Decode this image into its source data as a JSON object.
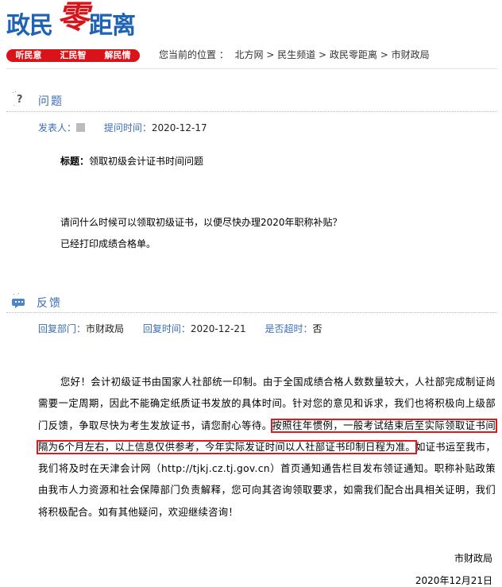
{
  "logo": {
    "left": "政民",
    "mid": "零",
    "right": "距离"
  },
  "slogans": [
    "听民意",
    "汇民智",
    "解民情"
  ],
  "breadcrumb": {
    "prefix": "您当前的位置 ：",
    "items": [
      "北方网",
      "民生频道",
      "政民零距离",
      "市财政局"
    ],
    "sep": ">"
  },
  "question": {
    "section_title": "问题",
    "poster_label": "发表人：",
    "time_label": "提问时间：",
    "time_value": "2020-12-17",
    "subject_label": "标题：",
    "subject_value": "领取初级会计证书时间问题",
    "lines": [
      "请问什么时候可以领取初级证书，以便尽快办理2020年职称补贴？",
      "已经打印成绩合格单。"
    ]
  },
  "feedback": {
    "section_title": "反馈",
    "dept_label": "回复部门：",
    "dept_value": "市财政局",
    "time_label": "回复时间：",
    "time_value": "2020-12-21",
    "overdue_label": "是否超时：",
    "overdue_value": "否",
    "body_part1": "您好！会计初级证书由国家人社部统一印制。由于全国成绩合格人数数量较大，人社部完成制证尚需要一定周期，因此不能确定纸质证书发放的具体时间。针对您的意见和诉求，我们也将积极向上级部门反馈，争取尽快为考生发放证书，请您耐心等待。",
    "body_highlight": "按照往年惯例，一般考试结束后至实际领取证书间隔为6个月左右，以上信息仅供参考，今年实际发证时间以人社部证书印制日程为准。",
    "body_part2": "如证书运至我市，我们将及时在天津会计网（http://tjkj.cz.tj.gov.cn）首页通知通告栏目发布领证通知。职称补贴政策由我市人力资源和社会保障部门负责解释，您可向其咨询领取要求，如需我们配合出具相关证明，我们将积极配合。如有其他疑问，欢迎继续咨询！",
    "signature": "市财政局",
    "date": "2020年12月21日"
  },
  "colors": {
    "brand_blue": "#1e63b5",
    "brand_red": "#d8141a",
    "label_blue": "#3c6db5",
    "highlight": "#e0191f"
  }
}
